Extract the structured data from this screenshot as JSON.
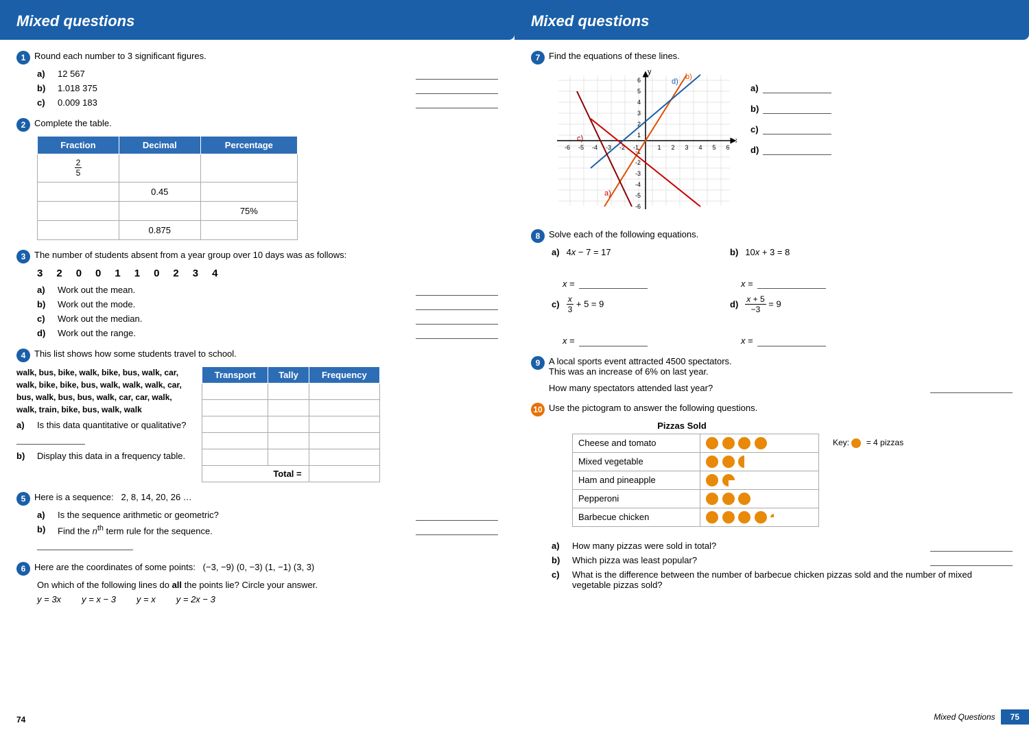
{
  "leftPage": {
    "title": "Mixed questions",
    "pageNumber": "74",
    "questions": {
      "q1": {
        "number": "1",
        "text": "Round each number to 3 significant figures.",
        "parts": [
          {
            "label": "a)",
            "value": "12 567"
          },
          {
            "label": "b)",
            "value": "1.018 375"
          },
          {
            "label": "c)",
            "value": "0.009 183"
          }
        ]
      },
      "q2": {
        "number": "2",
        "text": "Complete the table.",
        "headers": [
          "Fraction",
          "Decimal",
          "Percentage"
        ],
        "rows": [
          {
            "fraction": "2/5",
            "decimal": "",
            "percentage": ""
          },
          {
            "fraction": "",
            "decimal": "0.45",
            "percentage": ""
          },
          {
            "fraction": "",
            "decimal": "",
            "percentage": "75%"
          },
          {
            "fraction": "",
            "decimal": "0.875",
            "percentage": ""
          }
        ]
      },
      "q3": {
        "number": "3",
        "text": "The number of students absent from a year group over 10 days was as follows:",
        "data": [
          "3",
          "2",
          "0",
          "0",
          "1",
          "1",
          "0",
          "2",
          "3",
          "4"
        ],
        "parts": [
          {
            "label": "a)",
            "text": "Work out the mean."
          },
          {
            "label": "b)",
            "text": "Work out the mode."
          },
          {
            "label": "c)",
            "text": "Work out the median."
          },
          {
            "label": "d)",
            "text": "Work out the range."
          }
        ]
      },
      "q4": {
        "number": "4",
        "text": "This list shows how some students travel to school.",
        "listText": "walk, bus, bike, walk, bike, bus, walk, car, walk, bike, bike, bus, walk, walk, walk, car, bus, walk, bus, bus, walk, car, car, walk, walk, train, bike, bus, walk, walk",
        "tableHeaders": [
          "Transport",
          "Tally",
          "Frequency"
        ],
        "tableRows": [
          "",
          "",
          "",
          "",
          "",
          ""
        ],
        "totalLabel": "Total =",
        "parts": [
          {
            "label": "a)",
            "text": "Is this data quantitative or qualitative?"
          },
          {
            "label": "b)",
            "text": "Display this data in a frequency table."
          }
        ]
      },
      "q5": {
        "number": "5",
        "text": "Here is a sequence:   2, 8, 14, 20, 26 …",
        "parts": [
          {
            "label": "a)",
            "text": "Is the sequence arithmetic or geometric?"
          },
          {
            "label": "b)",
            "text": "Find the nth term rule for the sequence."
          }
        ]
      },
      "q6": {
        "number": "6",
        "text": "Here are the coordinates of some points:   (−3, −9)  (0, −3)  (1, −1)  (3, 3)",
        "text2": "On which of the following lines do all the points lie? Circle your answer.",
        "options": [
          "y = 3x",
          "y = x − 3",
          "y = x",
          "y = 2x − 3"
        ]
      }
    }
  },
  "rightPage": {
    "title": "Mixed questions",
    "pageNumber": "75",
    "pageLabel": "Mixed Questions",
    "questions": {
      "q7": {
        "number": "7",
        "text": "Find the equations of these lines.",
        "graphLabels": {
          "xAxis": "x",
          "yAxis": "y",
          "lines": [
            "a)",
            "b)",
            "c)",
            "d)"
          ]
        },
        "answerLabels": [
          "a)",
          "b)",
          "c)",
          "d)"
        ]
      },
      "q8": {
        "number": "8",
        "text": "Solve each of the following equations.",
        "parts": [
          {
            "label": "a)",
            "equation": "4x − 7 = 17",
            "xEquals": "x ="
          },
          {
            "label": "b)",
            "equation": "10x + 3 = 8",
            "xEquals": "x ="
          },
          {
            "label": "c)",
            "equation": "x/3 + 5 = 9",
            "xEquals": "x ="
          },
          {
            "label": "d)",
            "equation": "(x + 5)/−3 = 9",
            "xEquals": "x ="
          }
        ]
      },
      "q9": {
        "number": "9",
        "text": "A local sports event attracted 4500 spectators.",
        "text2": "This was an increase of 6% on last year.",
        "question": "How many spectators attended last year?"
      },
      "q10": {
        "number": "10",
        "text": "Use the pictogram to answer the following questions.",
        "tableTitle": "Pizzas Sold",
        "keyText": "= 4 pizzas",
        "rows": [
          {
            "name": "Cheese and tomato",
            "circles": 4,
            "partial": "none"
          },
          {
            "name": "Mixed vegetable",
            "circles": 2,
            "partial": "half"
          },
          {
            "name": "Ham and pineapple",
            "circles": 1,
            "partial": "threequarter"
          },
          {
            "name": "Pepperoni",
            "circles": 3,
            "partial": "none"
          },
          {
            "name": "Barbecue chicken",
            "circles": 4,
            "partial": "quarter"
          }
        ],
        "parts": [
          {
            "label": "a)",
            "text": "How many pizzas were sold in total?"
          },
          {
            "label": "b)",
            "text": "Which pizza was least popular?"
          },
          {
            "label": "c)",
            "text": "What is the difference between the number of barbecue chicken pizzas sold and the number of mixed vegetable pizzas sold?"
          }
        ]
      }
    }
  }
}
